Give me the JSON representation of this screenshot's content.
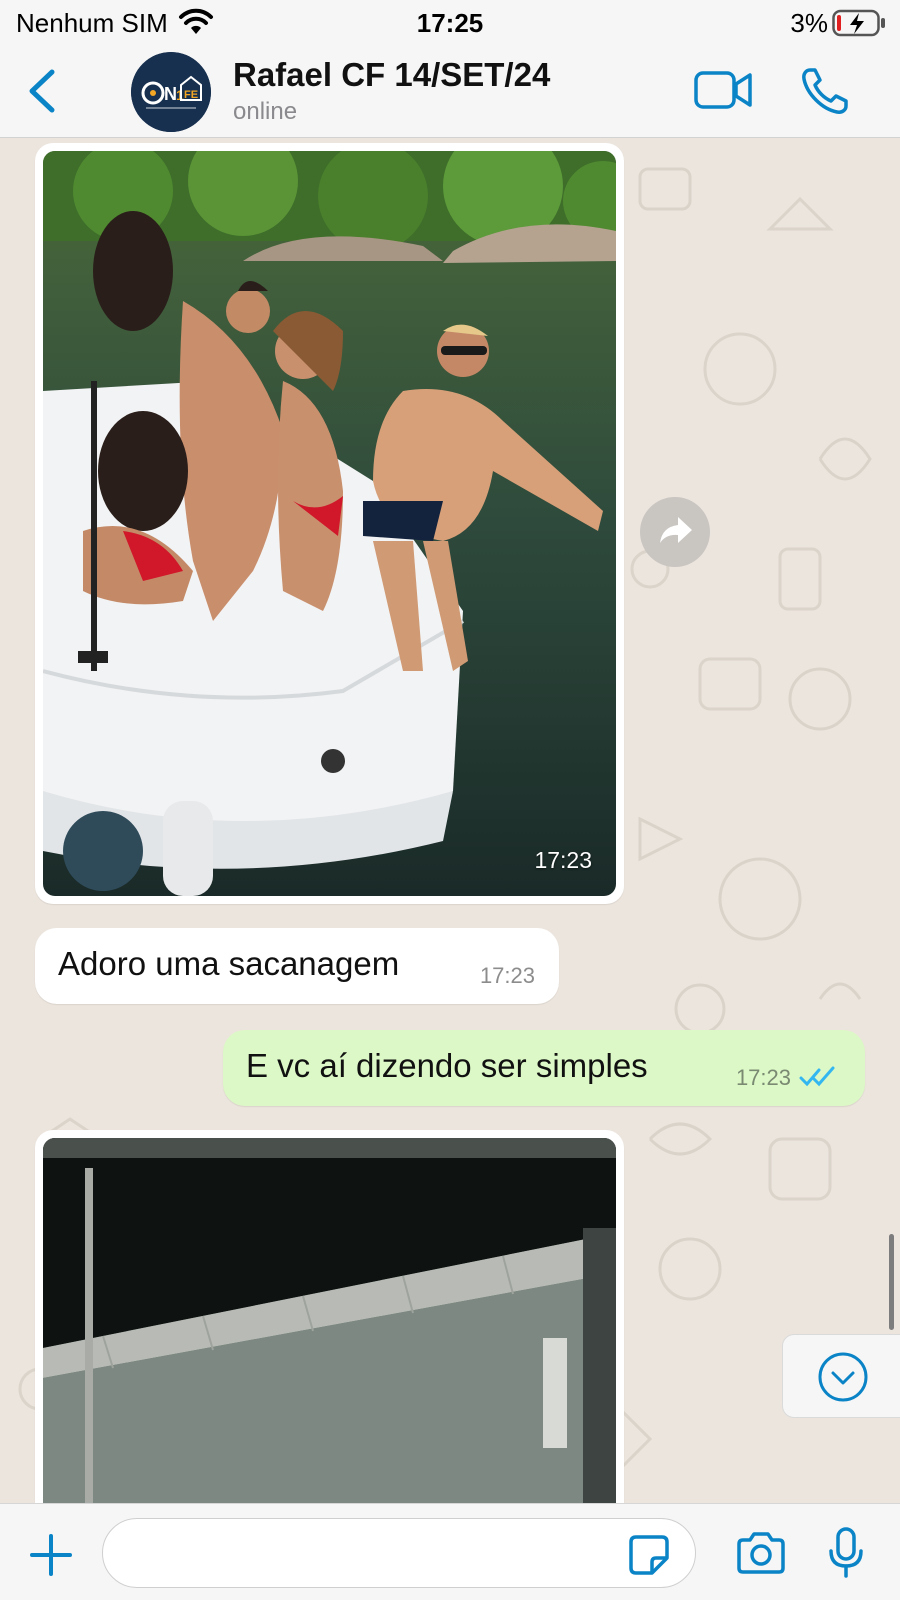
{
  "status_bar": {
    "carrier": "Nenhum SIM",
    "time": "17:25",
    "battery": "3%"
  },
  "header": {
    "contact_name": "Rafael CF 14/SET/24",
    "contact_status": "online",
    "avatar_text": "ON1FE"
  },
  "messages": [
    {
      "type": "image",
      "direction": "in",
      "time": "17:23",
      "description": "photo"
    },
    {
      "type": "text",
      "direction": "in",
      "text": "Adoro uma sacanagem",
      "time": "17:23"
    },
    {
      "type": "text",
      "direction": "out",
      "text": "E vc aí dizendo ser simples",
      "time": "17:23",
      "status": "read"
    },
    {
      "type": "image",
      "direction": "in",
      "time": "",
      "description": "photo"
    }
  ],
  "input": {
    "value": "",
    "placeholder": ""
  },
  "colors": {
    "accent": "#0A84C6",
    "outgoing_bubble": "#DCF8C6",
    "incoming_bubble": "#FFFFFF",
    "chat_background": "#ECE5DD",
    "read_ticks": "#34B7F1"
  },
  "icons": {
    "back": "chevron-left-icon",
    "video": "video-camera-icon",
    "call": "phone-icon",
    "forward": "forward-arrow-icon",
    "scroll_down": "chevron-down-circle-icon",
    "plus": "plus-icon",
    "sticker": "sticker-icon",
    "camera": "camera-icon",
    "mic": "microphone-icon"
  }
}
